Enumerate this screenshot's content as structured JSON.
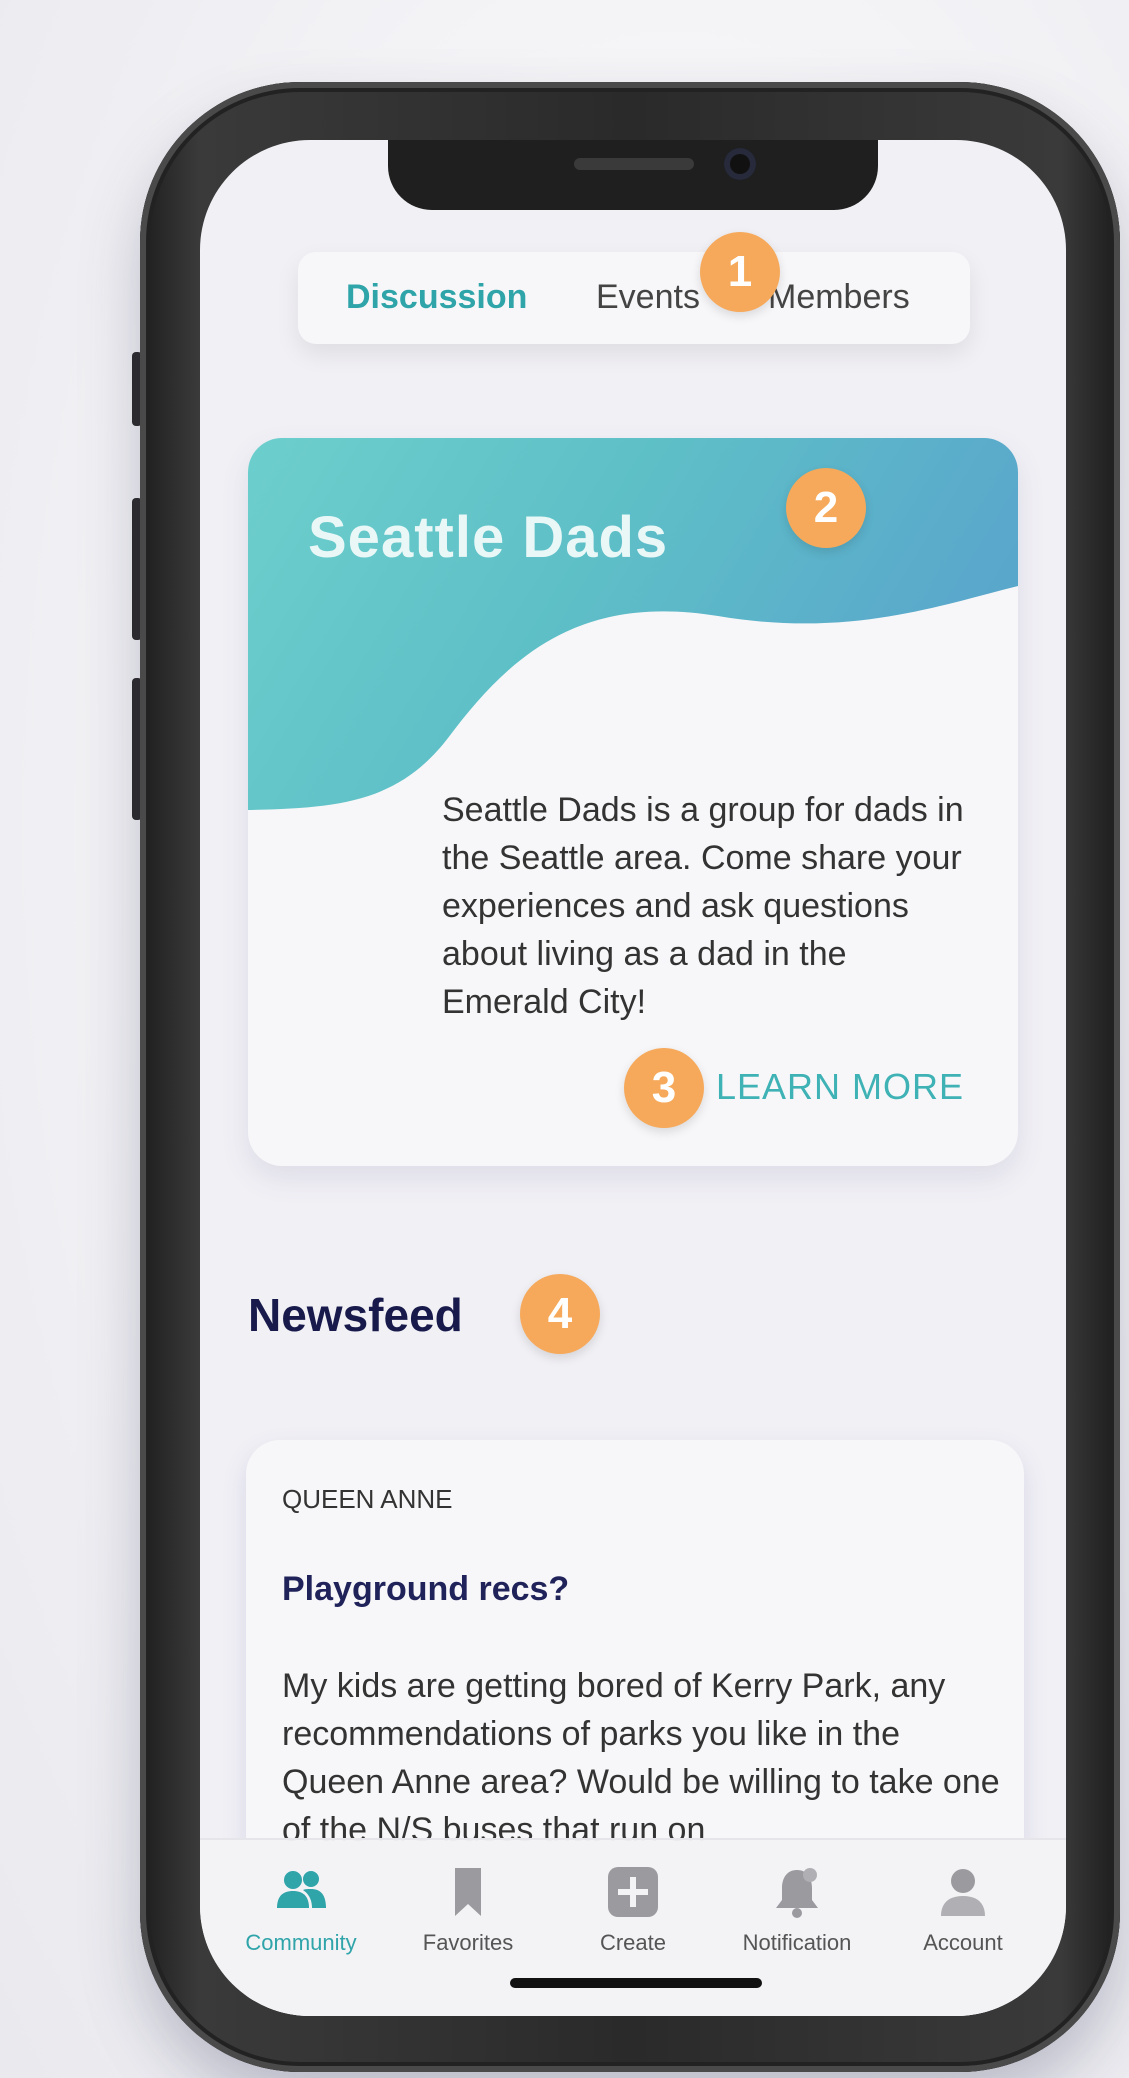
{
  "tabs": [
    {
      "label": "Discussion",
      "active": true
    },
    {
      "label": "Events",
      "active": false
    },
    {
      "label": "Members",
      "active": false
    }
  ],
  "group": {
    "title": "Seattle Dads",
    "description": "Seattle Dads is a group for dads in the Seattle area. Come share your experiences and ask questions about living as a dad in the Emerald City!",
    "learn_more": "LEARN MORE"
  },
  "newsfeed": {
    "title": "Newsfeed",
    "post": {
      "location": "QUEEN ANNE",
      "title": "Playground recs?",
      "body": "My kids are getting bored of Kerry Park, any recommendations of parks you like in the Queen Anne area? Would be willing to take one of the N/S buses that run on"
    }
  },
  "bottom_nav": [
    {
      "label": "Community",
      "icon": "community-icon",
      "active": true
    },
    {
      "label": "Favorites",
      "icon": "bookmark-icon",
      "active": false
    },
    {
      "label": "Create",
      "icon": "plus-icon",
      "active": false
    },
    {
      "label": "Notification",
      "icon": "bell-icon",
      "active": false
    },
    {
      "label": "Account",
      "icon": "user-icon",
      "active": false
    }
  ],
  "callouts": [
    "1",
    "2",
    "3",
    "4"
  ],
  "colors": {
    "accent_teal": "#2fa4a9",
    "callout_orange": "#f6a95a",
    "heading_navy": "#171a4a"
  }
}
